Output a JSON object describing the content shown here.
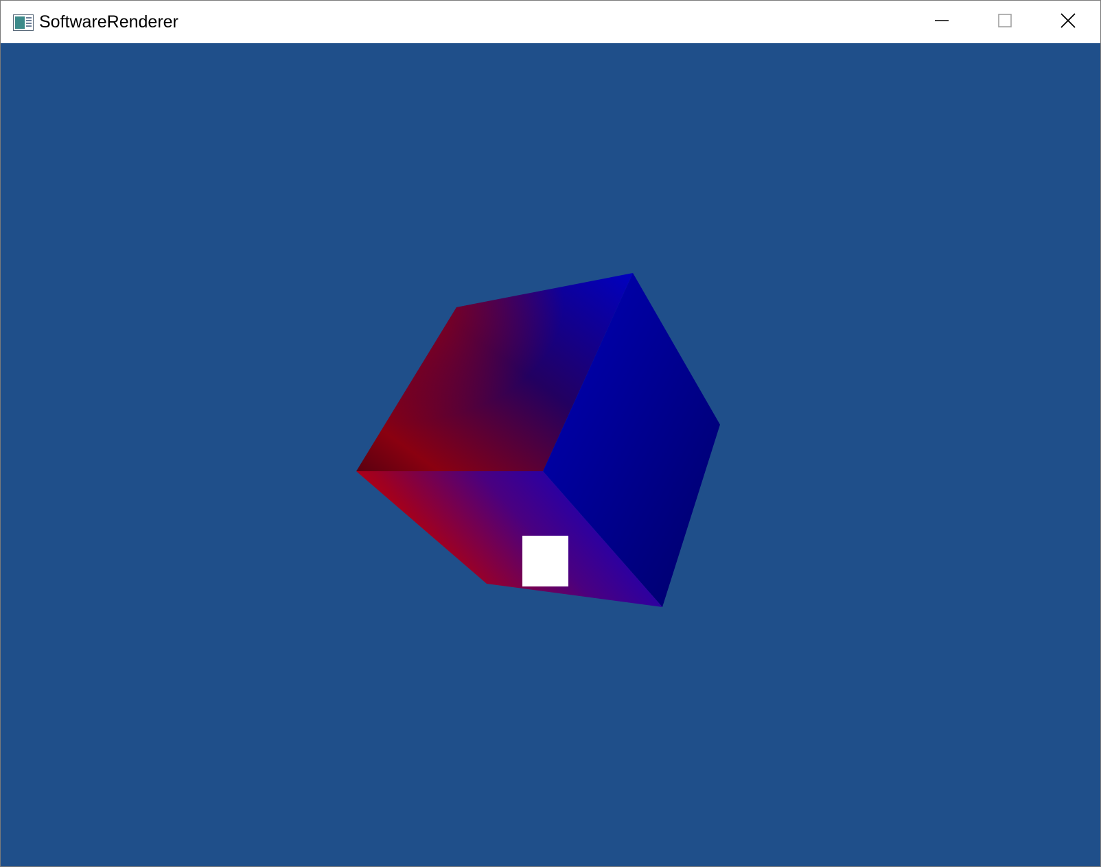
{
  "window": {
    "title": "SoftwareRenderer",
    "icon": "app-window-icon",
    "controls": {
      "minimize_icon": "minimize-icon",
      "maximize_icon": "maximize-icon",
      "close_icon": "close-icon"
    }
  },
  "viewport": {
    "background_color": "#1f4f8a",
    "scene": {
      "object": "cube",
      "face_colors": {
        "red": "#d40000",
        "blue": "#0000d0",
        "dark_blue": "#000070"
      },
      "marker_color": "#ffffff"
    }
  }
}
